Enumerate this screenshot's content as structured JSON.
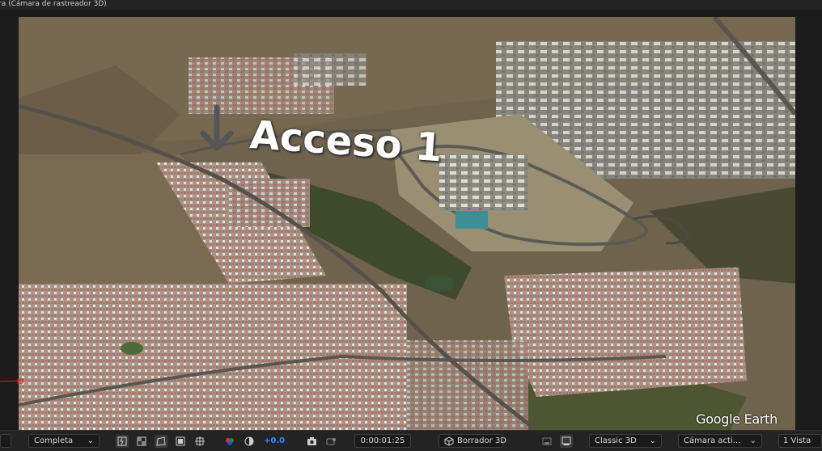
{
  "window": {
    "title": "ra (Cámara de rastreador 3D)"
  },
  "viewer": {
    "annotation_text": "Acceso 1",
    "watermark": "Google Earth"
  },
  "toolbar": {
    "partial_left": "",
    "resolution": "Completa",
    "exposure": "+0.0",
    "timecode": "0:00:01:25",
    "renderer": "Borrador 3D",
    "renderer_mode": "Classic 3D",
    "camera": "Cámara acti...",
    "views": "1 Vista"
  },
  "colors": {
    "accent": "#2d8cff",
    "panel_bg": "#1c1c1c",
    "toolbar_bg": "#232323"
  }
}
